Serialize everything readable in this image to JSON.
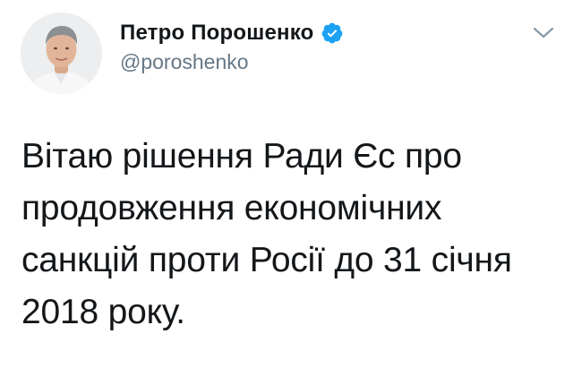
{
  "tweet": {
    "author": {
      "display_name": "Петро Порошенко",
      "handle": "@poroshenko",
      "verified": true
    },
    "text": "Вітаю рішення Ради Єс про продовження економічних санкцій проти Росії до 31 січня 2018 року.",
    "icons": {
      "verified": "verified-badge-icon",
      "caret": "chevron-down-icon"
    }
  },
  "colors": {
    "verified_blue": "#1da1f2",
    "handle_gray": "#657786",
    "text": "#14171a",
    "caret_gray": "#8899a6"
  }
}
